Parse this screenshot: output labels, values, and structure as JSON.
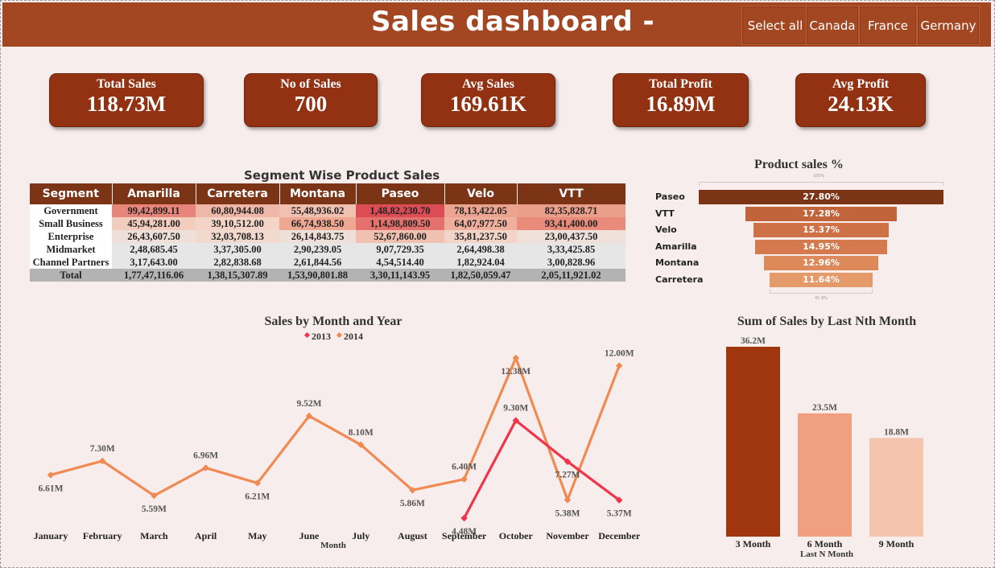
{
  "header": {
    "title": "Sales dashboard -",
    "slicers": [
      "Select all",
      "Canada",
      "France",
      "Germany"
    ]
  },
  "kpis": [
    {
      "label": "Total Sales",
      "value": "118.73M"
    },
    {
      "label": "No of Sales",
      "value": "700"
    },
    {
      "label": "Avg Sales",
      "value": "169.61K"
    },
    {
      "label": "Total Profit",
      "value": "16.89M"
    },
    {
      "label": "Avg Profit",
      "value": "24.13K"
    }
  ],
  "matrix": {
    "title": "Segment Wise Product Sales",
    "columns": [
      "Segment",
      "Amarilla",
      "Carretera",
      "Montana",
      "Paseo",
      "Velo",
      "VTT"
    ],
    "rows": [
      {
        "segment": "Government",
        "values": [
          "99,42,899.11",
          "60,80,944.08",
          "55,48,936.02",
          "1,48,82,230.70",
          "78,13,422.05",
          "82,35,828.71"
        ],
        "colors": [
          "#e8857a",
          "#efb7a7",
          "#f0c0b0",
          "#dc4c55",
          "#eba48f",
          "#ea9f8a"
        ]
      },
      {
        "segment": "Small Business",
        "values": [
          "45,94,281.00",
          "39,10,512.00",
          "66,74,938.50",
          "1,14,98,809.50",
          "64,07,977.50",
          "93,41,400.00"
        ],
        "colors": [
          "#f2cdbd",
          "#f3d4c6",
          "#eea790",
          "#e4716c",
          "#efaf9c",
          "#e88b7a"
        ]
      },
      {
        "segment": "Enterprise",
        "values": [
          "26,43,607.50",
          "32,03,708.13",
          "26,14,843.75",
          "52,67,860.00",
          "35,81,237.50",
          "23,00,437.50"
        ],
        "colors": [
          "#eedfd8",
          "#f1d9ce",
          "#eedfd8",
          "#f0c1b1",
          "#f2d4c8",
          "#efe1da"
        ]
      },
      {
        "segment": "Midmarket",
        "values": [
          "2,48,685.45",
          "3,37,305.00",
          "2,90,239.05",
          "9,07,729.35",
          "2,64,498.38",
          "3,33,425.85"
        ],
        "colors": [
          "#e6e6e6",
          "#e6e6e6",
          "#e6e6e6",
          "#e6e6e6",
          "#e6e6e6",
          "#e6e6e6"
        ]
      },
      {
        "segment": "Channel Partners",
        "values": [
          "3,17,643.00",
          "2,82,838.68",
          "2,61,844.56",
          "4,54,514.40",
          "1,82,924.04",
          "3,00,828.96"
        ],
        "colors": [
          "#e6e6e6",
          "#e6e6e6",
          "#e6e6e6",
          "#e6e6e6",
          "#e6e6e6",
          "#e6e6e6"
        ]
      }
    ],
    "total": {
      "segment": "Total",
      "values": [
        "1,77,47,116.06",
        "1,38,15,307.89",
        "1,53,90,801.88",
        "3,30,11,143.95",
        "1,82,50,059.47",
        "2,05,11,921.02"
      ]
    }
  },
  "chart_data": [
    {
      "type": "bar",
      "title": "Product sales %",
      "categories": [
        "Paseo",
        "VTT",
        "Velo",
        "Amarilla",
        "Montana",
        "Carretera"
      ],
      "values": [
        27.8,
        17.28,
        15.37,
        14.95,
        12.96,
        11.64
      ],
      "labels": [
        "27.80%",
        "17.28%",
        "15.37%",
        "14.95%",
        "12.96%",
        "11.64%"
      ],
      "colors": [
        "#7b3416",
        "#c1633b",
        "#ce7147",
        "#d57a4f",
        "#de8959",
        "#e59a6a"
      ],
      "top_caption": "100%",
      "bottom_caption": "41.9%"
    },
    {
      "type": "line",
      "title": "Sales by Month and Year",
      "xlabel": "Month",
      "categories": [
        "January",
        "February",
        "March",
        "April",
        "May",
        "June",
        "July",
        "August",
        "September",
        "October",
        "November",
        "December"
      ],
      "series": [
        {
          "name": "2013",
          "color": "#f0344a",
          "start_index": 8,
          "values": [
            4.48,
            9.3,
            7.27,
            5.37
          ],
          "labels": [
            "4.48M",
            "9.30M",
            "7.27M",
            "5.37M"
          ]
        },
        {
          "name": "2014",
          "color": "#f08a52",
          "start_index": 0,
          "values": [
            6.61,
            7.3,
            5.59,
            6.96,
            6.21,
            9.52,
            8.1,
            5.86,
            6.4,
            12.38,
            5.38,
            12.0
          ],
          "labels": [
            "6.61M",
            "7.30M",
            "5.59M",
            "6.96M",
            "6.21M",
            "9.52M",
            "8.10M",
            "5.86M",
            "6.40M",
            "12.38M",
            "5.38M",
            "12.00M"
          ]
        }
      ]
    },
    {
      "type": "bar",
      "title": "Sum of Sales by Last Nth Month",
      "xlabel": "Last N Month",
      "categories": [
        "3 Month",
        "6 Month",
        "9 Month"
      ],
      "values": [
        36.2,
        23.5,
        18.8
      ],
      "labels": [
        "36.2M",
        "23.5M",
        "18.8M"
      ],
      "colors": [
        "#a0360e",
        "#f0a07e",
        "#f4c4ad"
      ]
    }
  ]
}
